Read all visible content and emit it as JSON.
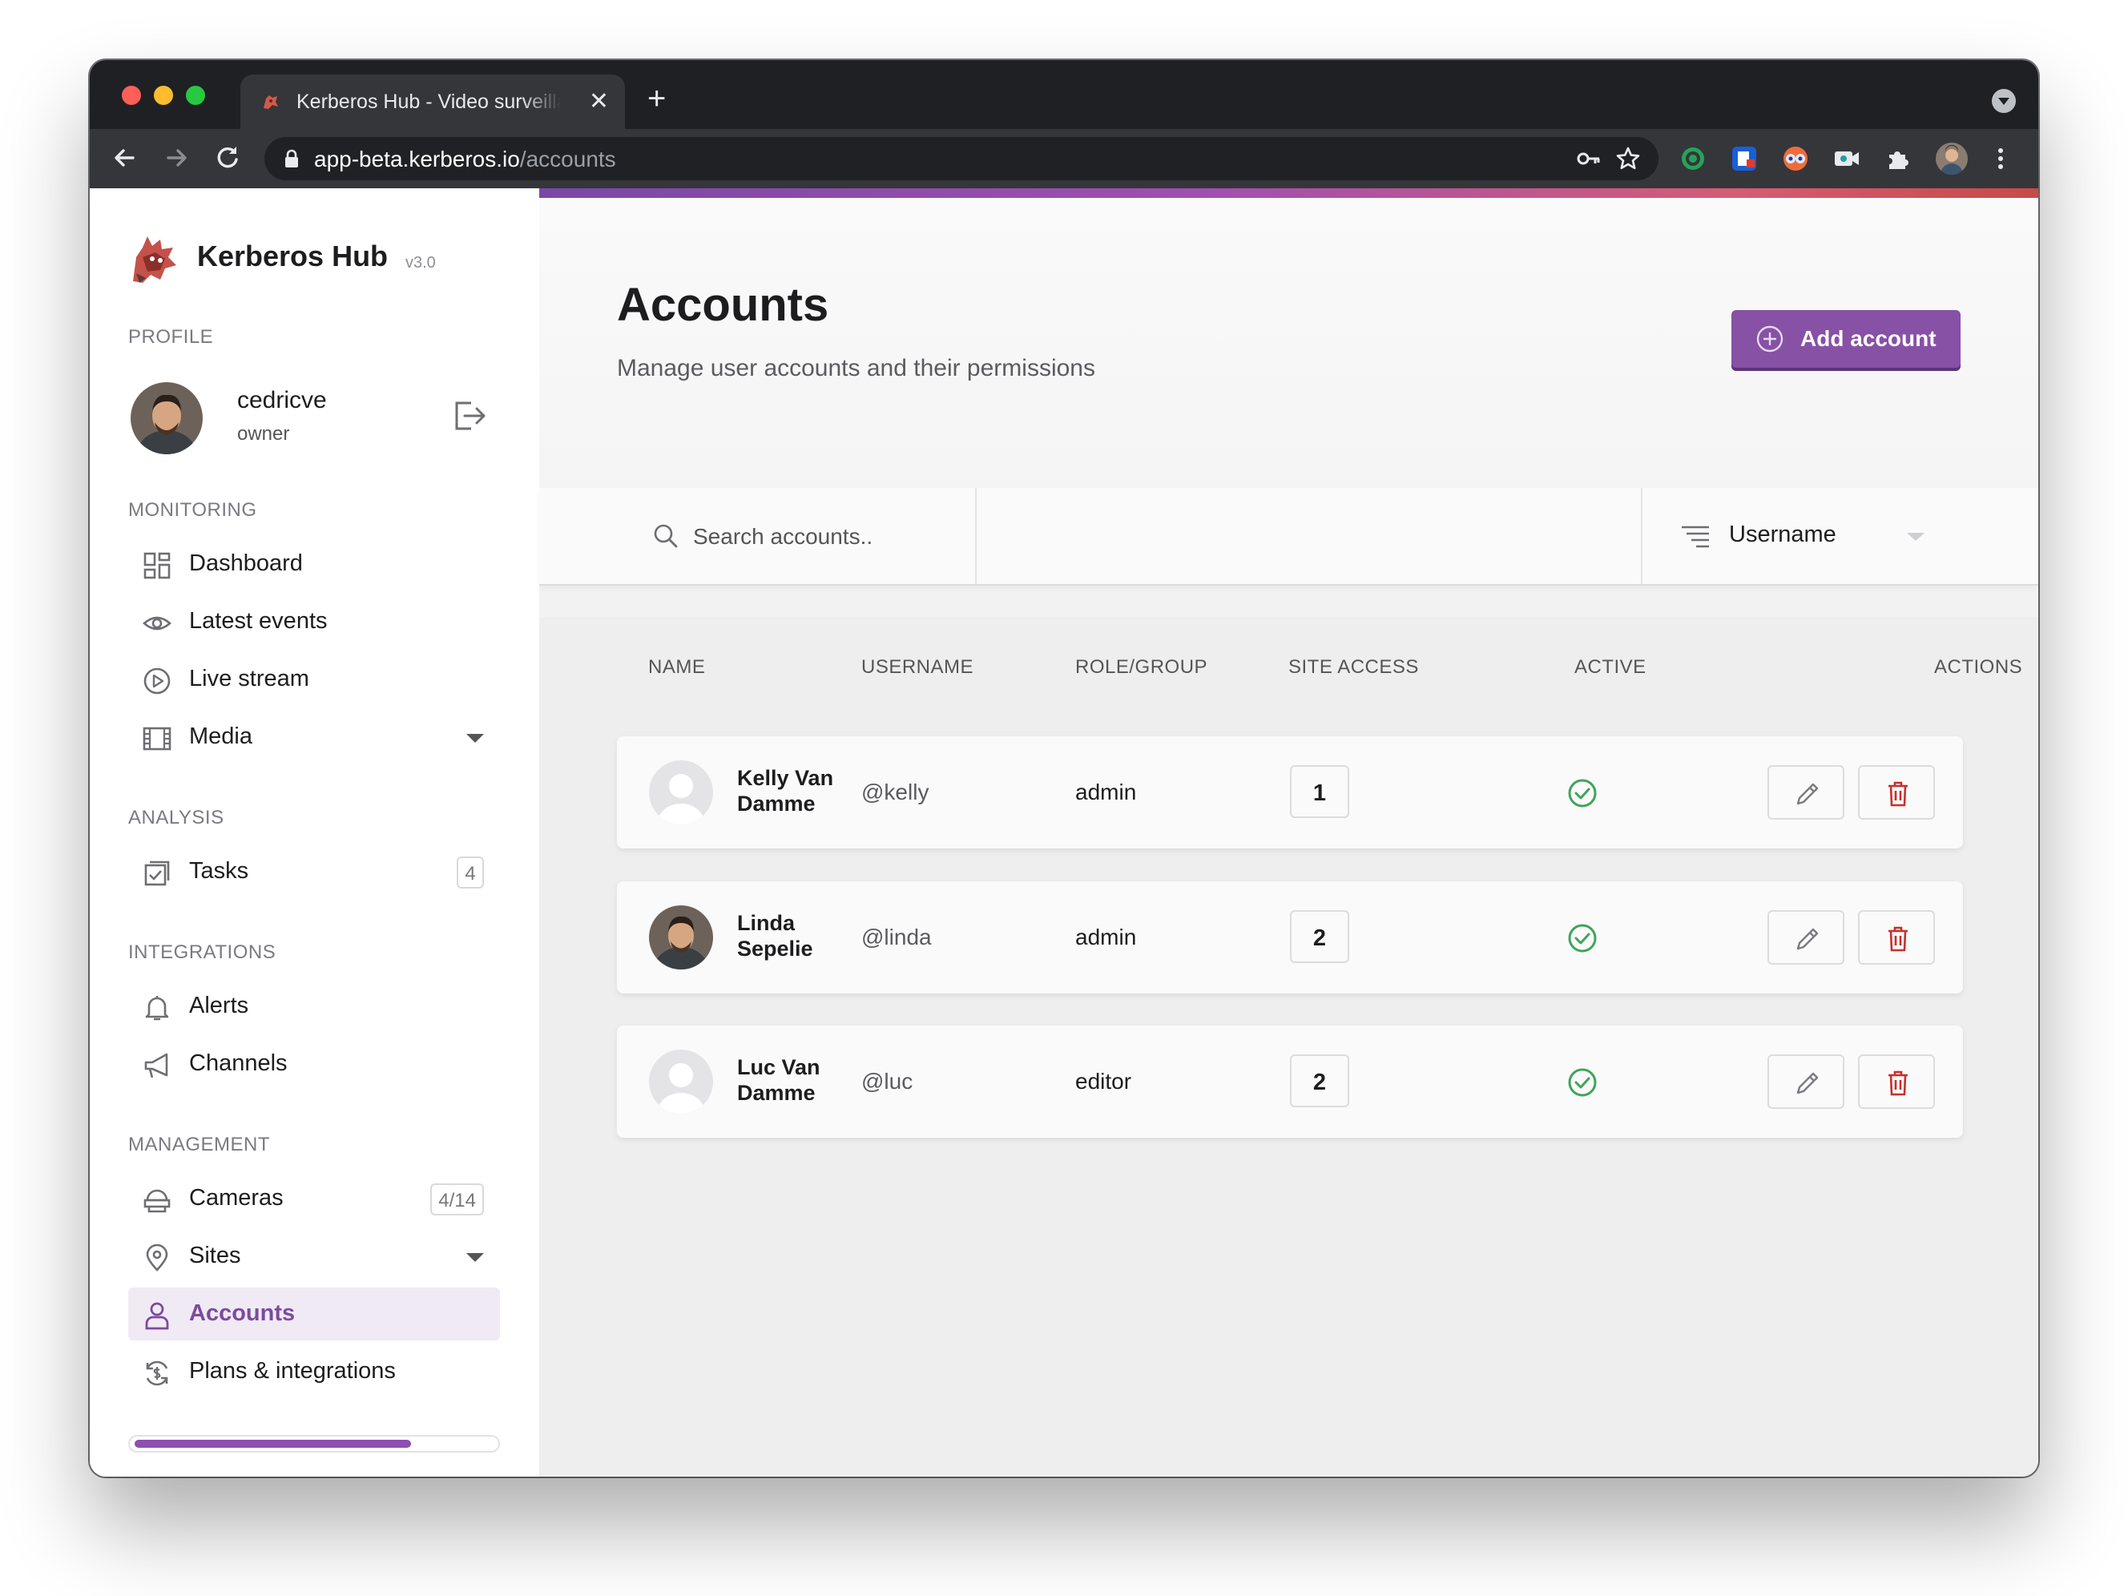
{
  "browser": {
    "tab_title": "Kerberos Hub - Video surveillance",
    "url_host": "app-beta.kerberos.io",
    "url_path": "/accounts",
    "new_tab_label": "+",
    "close_tab_label": "✕"
  },
  "sidebar": {
    "app_name": "Kerberos Hub",
    "version": "v3.0",
    "sections": {
      "profile": "PROFILE",
      "monitoring": "MONITORING",
      "analysis": "ANALYSIS",
      "integrations": "INTEGRATIONS",
      "management": "MANAGEMENT"
    },
    "profile": {
      "username": "cedricve",
      "role": "owner"
    },
    "items": {
      "dashboard": {
        "label": "Dashboard",
        "icon": "grid-icon"
      },
      "latest_events": {
        "label": "Latest events",
        "icon": "eye-icon"
      },
      "live_stream": {
        "label": "Live stream",
        "icon": "play-circle-icon"
      },
      "media": {
        "label": "Media",
        "icon": "film-icon"
      },
      "tasks": {
        "label": "Tasks",
        "icon": "checkbox-icon",
        "badge": "4"
      },
      "alerts": {
        "label": "Alerts",
        "icon": "bell-icon"
      },
      "channels": {
        "label": "Channels",
        "icon": "megaphone-icon"
      },
      "cameras": {
        "label": "Cameras",
        "icon": "camera-icon",
        "badge": "4/14"
      },
      "sites": {
        "label": "Sites",
        "icon": "map-pin-icon"
      },
      "accounts": {
        "label": "Accounts",
        "icon": "user-icon",
        "active": true
      },
      "plans": {
        "label": "Plans & integrations",
        "icon": "dollar-cycle-icon"
      }
    },
    "usage_progress": 0.77
  },
  "page": {
    "title": "Accounts",
    "subtitle": "Manage user accounts and their permissions",
    "add_button": "Add account"
  },
  "filters": {
    "search_placeholder": "Search accounts..",
    "sort_value": "Username"
  },
  "table": {
    "headers": {
      "name": "NAME",
      "username": "USERNAME",
      "role": "ROLE/GROUP",
      "site_access": "SITE ACCESS",
      "active": "ACTIVE",
      "actions": "ACTIONS"
    },
    "rows": [
      {
        "name": "Kelly Van Damme",
        "username": "@kelly",
        "role": "admin",
        "site_access": "1",
        "active": true,
        "avatar": "default-avatar"
      },
      {
        "name": "Linda Sepelie",
        "username": "@linda",
        "role": "admin",
        "site_access": "2",
        "active": true,
        "avatar": "photo-avatar"
      },
      {
        "name": "Luc Van Damme",
        "username": "@luc",
        "role": "editor",
        "site_access": "2",
        "active": true,
        "avatar": "default-avatar"
      }
    ]
  },
  "colors": {
    "accent": "#8751a6",
    "active_check": "#3fa45a",
    "delete": "#c8302c",
    "window_chrome": "#1f2023"
  }
}
